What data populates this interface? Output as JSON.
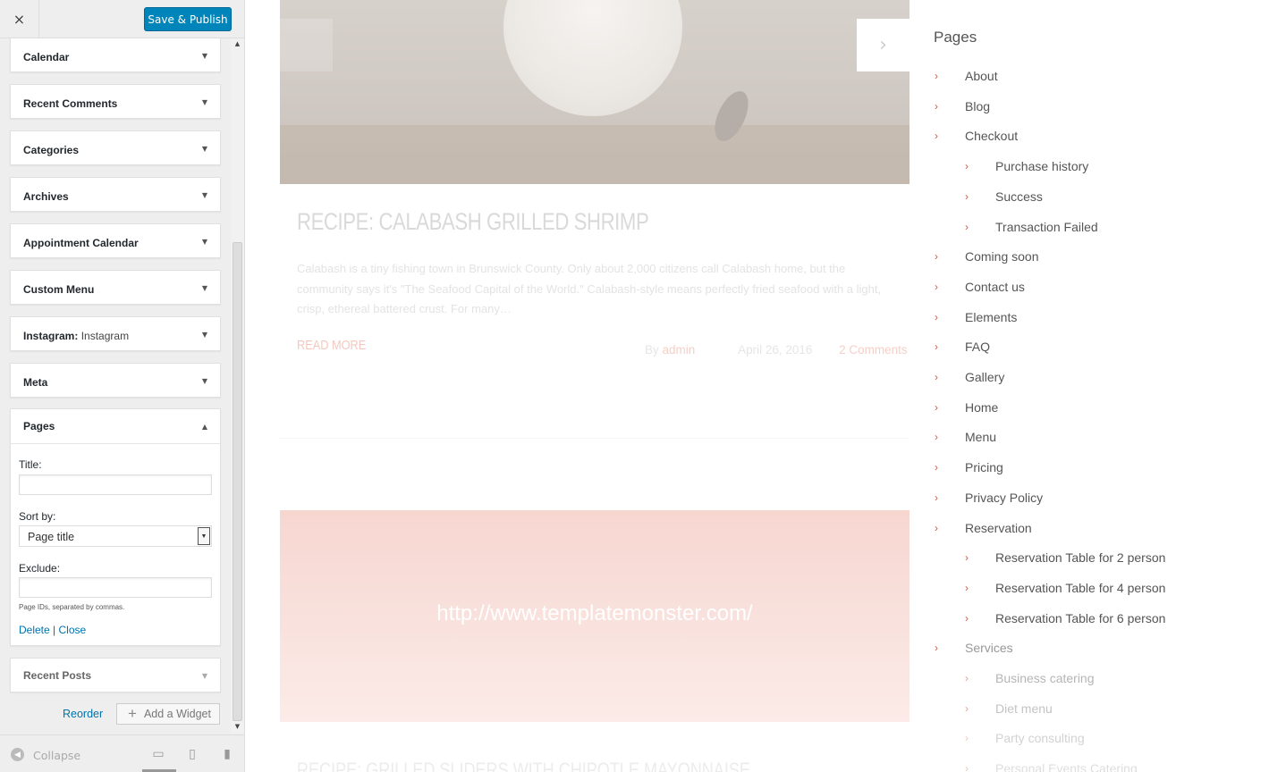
{
  "customizer": {
    "close_icon": "×",
    "publish_label": "Save & Publish",
    "widgets": [
      {
        "title": "Calendar",
        "sub": ""
      },
      {
        "title": "Recent Comments",
        "sub": ""
      },
      {
        "title": "Categories",
        "sub": ""
      },
      {
        "title": "Archives",
        "sub": ""
      },
      {
        "title": "Appointment Calendar",
        "sub": ""
      },
      {
        "title": "Custom Menu",
        "sub": ""
      },
      {
        "title": "Instagram",
        "sub": "Instagram"
      },
      {
        "title": "Meta",
        "sub": ""
      }
    ],
    "pages_widget": {
      "title": "Pages",
      "title_label": "Title:",
      "title_value": "",
      "sort_label": "Sort by:",
      "sort_value": "Page title",
      "exclude_label": "Exclude:",
      "exclude_value": "",
      "help": "Page IDs, separated by commas.",
      "delete_label": "Delete",
      "separator": "|",
      "close_label": "Close"
    },
    "recent_posts_title": "Recent Posts",
    "reorder_label": "Reorder",
    "add_widget_label": "Add a Widget",
    "collapse_label": "Collapse",
    "devices": [
      "desktop-icon",
      "tablet-icon",
      "mobile-icon"
    ]
  },
  "preview": {
    "post_title": "RECIPE: CALABASH GRILLED SHRIMP",
    "excerpt": "Calabash is a tiny fishing town in Brunswick County. Only about 2,000 citizens call Calabash home, but the community says it's \"The Seafood Capital of the World.\" Calabash-style means perfectly fried seafood with a light, crisp, ethereal battered crust. For many…",
    "read_more": "READ MORE",
    "meta_by": "By",
    "meta_author": "admin",
    "meta_date": "April 26, 2016",
    "meta_comments": "2 Comments",
    "site_url": "http://www.templatemonster.com/",
    "next_post_title": "RECIPE: GRILLED SLIDERS WITH CHIPOTLE MAYONNAISE",
    "sidebar_heading": "Pages",
    "pages": [
      {
        "label": "About",
        "level": 0
      },
      {
        "label": "Blog",
        "level": 0
      },
      {
        "label": "Checkout",
        "level": 0
      },
      {
        "label": "Purchase history",
        "level": 1
      },
      {
        "label": "Success",
        "level": 1
      },
      {
        "label": "Transaction Failed",
        "level": 1
      },
      {
        "label": "Coming soon",
        "level": 0
      },
      {
        "label": "Contact us",
        "level": 0
      },
      {
        "label": "Elements",
        "level": 0
      },
      {
        "label": "FAQ",
        "level": 0
      },
      {
        "label": "Gallery",
        "level": 0
      },
      {
        "label": "Home",
        "level": 0
      },
      {
        "label": "Menu",
        "level": 0
      },
      {
        "label": "Pricing",
        "level": 0
      },
      {
        "label": "Privacy Policy",
        "level": 0
      },
      {
        "label": "Reservation",
        "level": 0
      },
      {
        "label": "Reservation Table for 2 person",
        "level": 1
      },
      {
        "label": "Reservation Table for 4 person",
        "level": 1
      },
      {
        "label": "Reservation Table for 6 person",
        "level": 1
      },
      {
        "label": "Services",
        "level": 0
      },
      {
        "label": "Business catering",
        "level": 1
      },
      {
        "label": "Diet menu",
        "level": 1
      },
      {
        "label": "Party consulting",
        "level": 1
      },
      {
        "label": "Personal Events Catering",
        "level": 1
      }
    ]
  }
}
